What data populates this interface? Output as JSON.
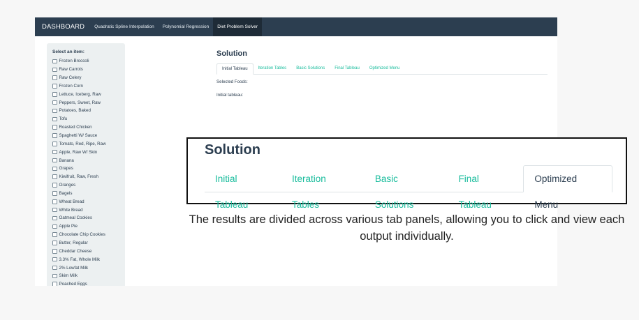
{
  "navbar": {
    "brand": "DASHBOARD",
    "items": [
      {
        "label": "Quadratic Spline Interpolation"
      },
      {
        "label": "Polynomial Regression"
      },
      {
        "label": "Diet Problem Solver"
      }
    ]
  },
  "sidebar": {
    "title": "Select an item:",
    "items": [
      {
        "label": "Frozen Broccoli"
      },
      {
        "label": "Raw Carrots"
      },
      {
        "label": "Raw Celery"
      },
      {
        "label": "Frozen Corn"
      },
      {
        "label": "Lettuce, Iceberg, Raw"
      },
      {
        "label": "Peppers, Sweet, Raw"
      },
      {
        "label": "Potatoes, Baked"
      },
      {
        "label": "Tofu"
      },
      {
        "label": "Roasted Chicken"
      },
      {
        "label": "Spaghetti W/ Sauce"
      },
      {
        "label": "Tomato, Red, Ripe, Raw"
      },
      {
        "label": "Apple, Raw W/ Skin"
      },
      {
        "label": "Banana"
      },
      {
        "label": "Grapes"
      },
      {
        "label": "Kiwifruit, Raw, Fresh"
      },
      {
        "label": "Oranges"
      },
      {
        "label": "Bagels"
      },
      {
        "label": "Wheat Bread"
      },
      {
        "label": "White Bread"
      },
      {
        "label": "Oatmeal Cookies"
      },
      {
        "label": "Apple Pie"
      },
      {
        "label": "Chocolate Chip Cookies"
      },
      {
        "label": "Butter, Regular"
      },
      {
        "label": "Cheddar Cheese"
      },
      {
        "label": "3.3% Fat, Whole Milk"
      },
      {
        "label": "2% Lowfat Milk"
      },
      {
        "label": "Skim Milk"
      },
      {
        "label": "Poached Eggs"
      }
    ]
  },
  "main": {
    "title": "Solution",
    "tabs": [
      {
        "label": "Initial Tableau"
      },
      {
        "label": "Iteration Tables"
      },
      {
        "label": "Basic Solutions"
      },
      {
        "label": "Final Tableau"
      },
      {
        "label": "Optimized Menu"
      }
    ],
    "selected_foods_label": "Selected Foods:",
    "initial_tableau_label": "Initial tableau:"
  },
  "zoom": {
    "title": "Solution",
    "tabs": [
      {
        "label": "Initial Tableau"
      },
      {
        "label": "Iteration Tables"
      },
      {
        "label": "Basic Solutions"
      },
      {
        "label": "Final Tableau"
      },
      {
        "label": "Optimized Menu"
      }
    ]
  },
  "caption": "The results are divided across various tab panels, allowing you to click and view each output individually.",
  "colors": {
    "navbar": "#2c3e50",
    "accent": "#18bc9c",
    "sidebar": "#ecf0f1"
  }
}
